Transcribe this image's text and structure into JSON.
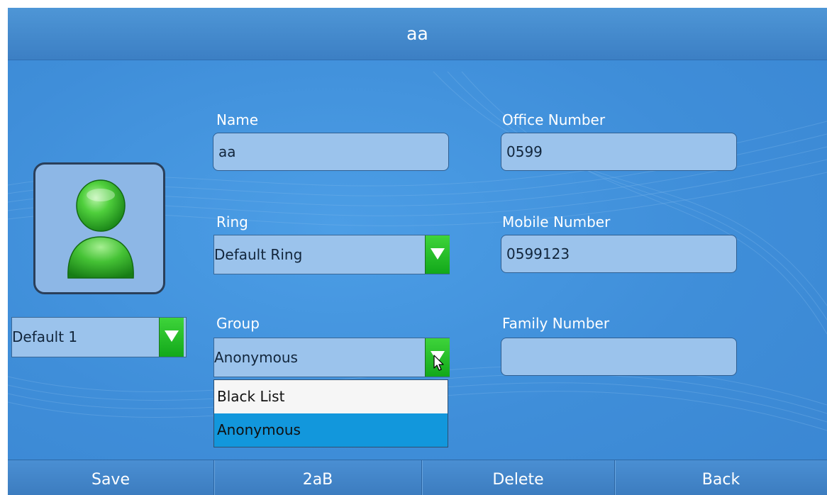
{
  "title": "aa",
  "avatar": {
    "icon": "contact-person-icon"
  },
  "photo_select": {
    "value": "Default 1"
  },
  "name": {
    "label": "Name",
    "value": "aa"
  },
  "ring": {
    "label": "Ring",
    "value": "Default Ring"
  },
  "group": {
    "label": "Group",
    "value": "Anonymous",
    "options": [
      "Black List",
      "Anonymous"
    ],
    "highlighted": "Anonymous"
  },
  "office_number": {
    "label": "Office Number",
    "value": "0599"
  },
  "mobile_number": {
    "label": "Mobile Number",
    "value": "0599123"
  },
  "family_number": {
    "label": "Family Number",
    "value": ""
  },
  "softkeys": [
    "Save",
    "2aB",
    "Delete",
    "Back"
  ],
  "colors": {
    "background": "#3f8ed9",
    "field": "#9bc3ec",
    "dropdown_arrow": "#1fb526",
    "highlight": "#1297dc"
  }
}
